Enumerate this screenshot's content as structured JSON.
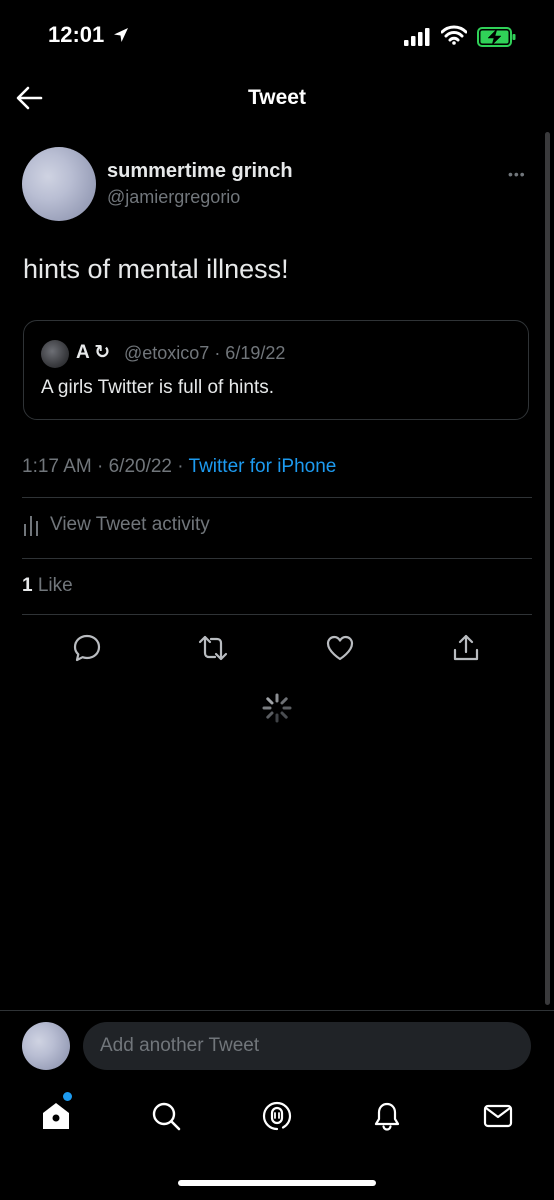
{
  "status_bar": {
    "time": "12:01",
    "icons": [
      "location-arrow-icon",
      "signal-icon",
      "wifi-icon",
      "battery-charging-icon"
    ],
    "battery_color": "#30d158"
  },
  "header": {
    "title": "Tweet",
    "back_icon": "back-arrow-icon"
  },
  "tweet": {
    "display_name": "summertime grinch",
    "handle": "@jamiergregorio",
    "more_icon": "•••",
    "text": "hints of mental illness!",
    "quote": {
      "name": "A ↻",
      "meta": "@etoxico7 · 6/19/22",
      "text": "A girls Twitter is full of hints."
    },
    "timestamp": "1:17 AM · 6/20/22 · ",
    "source": "Twitter for iPhone",
    "activity_label": "View Tweet activity",
    "like_count": "1",
    "like_label": " Like",
    "actions": [
      "reply-icon",
      "retweet-icon",
      "like-icon",
      "share-icon"
    ]
  },
  "compose": {
    "placeholder": "Add another Tweet"
  },
  "tab_bar": {
    "items": [
      "home-icon",
      "search-icon",
      "spaces-icon",
      "notifications-icon",
      "messages-icon"
    ],
    "accent": "#1d9bf0"
  }
}
